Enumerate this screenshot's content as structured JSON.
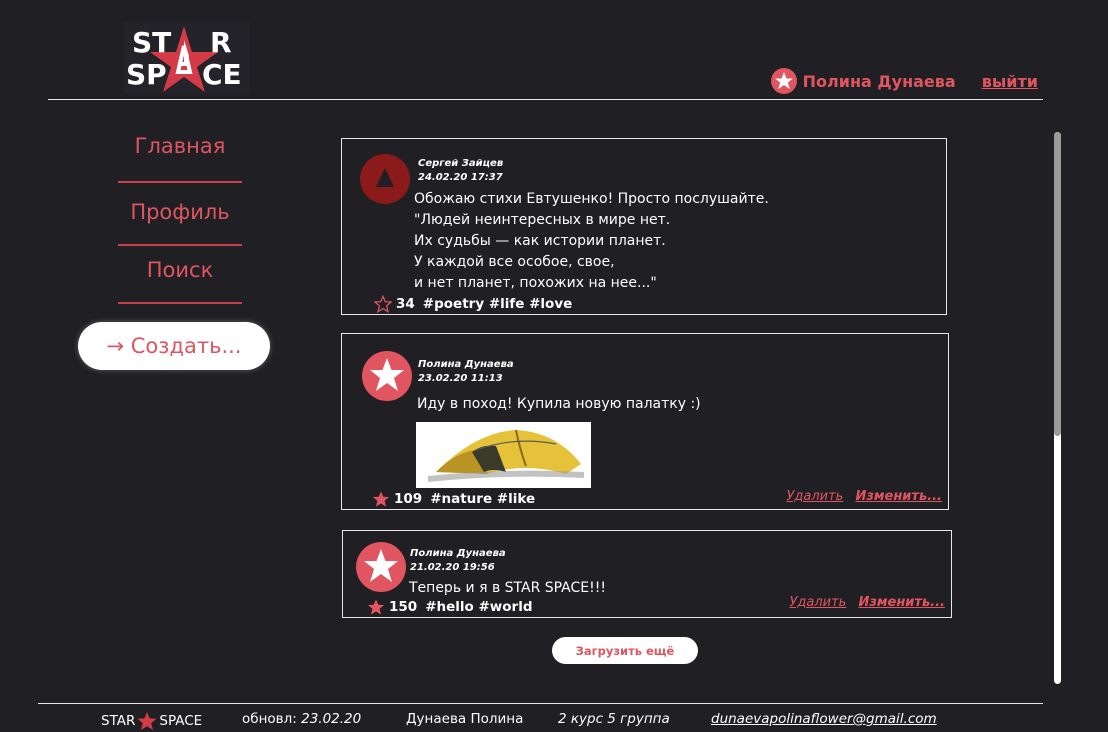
{
  "logo": {
    "line1": "ST R",
    "line2": "SP CE"
  },
  "header": {
    "user_name": "Полина Дунаева",
    "logout": "выйти"
  },
  "nav": {
    "items": [
      {
        "label": "Главная"
      },
      {
        "label": "Профиль"
      },
      {
        "label": "Поиск"
      }
    ],
    "create": "→ Создать..."
  },
  "posts": [
    {
      "author": "Сергей Зайцев",
      "date": "24.02.20 17:37",
      "text": "Обожаю стихи Евтушенко! Просто послушайте.\n\"Людей неинтересных в мире нет.\nИх судьбы — как истории планет.\nУ каждой все особое, свое,\nи нет планет, похожих на нее...\"",
      "likes": "34",
      "tags": "#poetry #life #love",
      "liked": false
    },
    {
      "author": "Полина Дунаева",
      "date": "23.02.20 11:13",
      "text": "Иду в поход! Купила новую палатку :)",
      "likes": "109",
      "tags": "#nature #like",
      "liked": true,
      "delete": "Удалить",
      "edit": "Изменить..."
    },
    {
      "author": "Полина Дунаева",
      "date": "21.02.20 19:56",
      "text": "Теперь и я в STAR SPACE!!!",
      "likes": "150",
      "tags": "#hello #world",
      "liked": true,
      "delete": "Удалить",
      "edit": "Изменить..."
    }
  ],
  "load_more": "Загрузить ещё",
  "footer": {
    "brand_left": "STAR",
    "brand_right": "SPACE",
    "updated_label": "обновл:",
    "updated_date": "23.02.20",
    "author": "Дунаева Полина",
    "group": "2 курс 5 группа",
    "email": "dunaevapolinaflower@gmail.com"
  },
  "colors": {
    "accent": "#e05560",
    "background": "#1f1f24",
    "dark_red": "#8b1a1a"
  },
  "scroll": {
    "thumb_fraction": 0.55
  }
}
